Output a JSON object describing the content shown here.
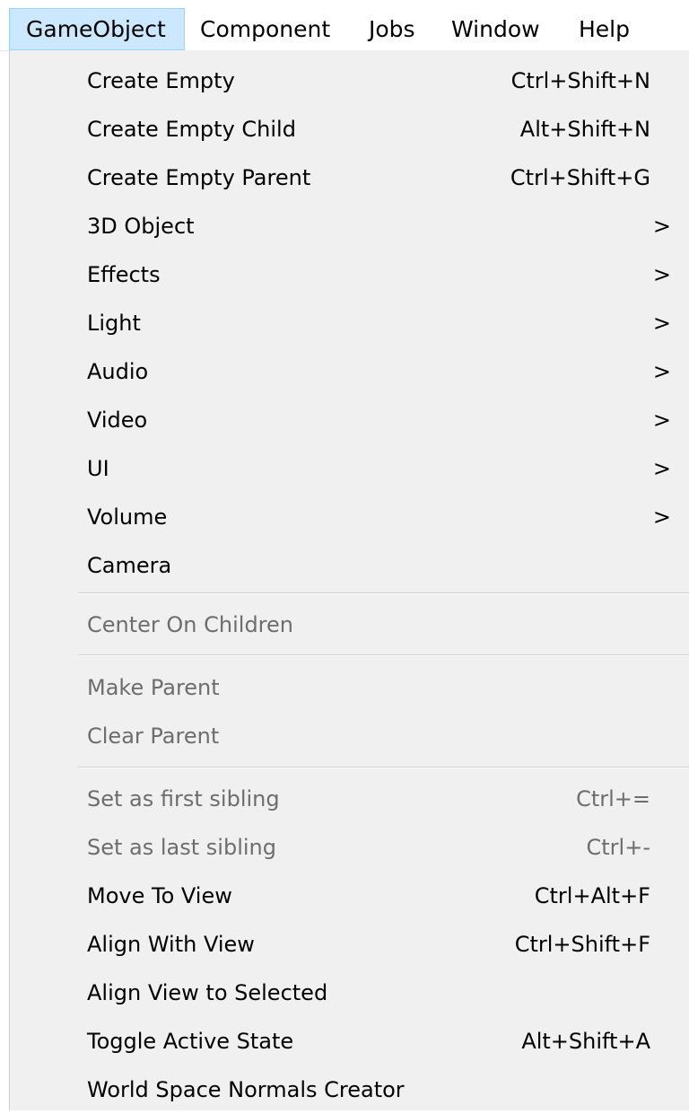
{
  "menubar": {
    "items": [
      {
        "label": "GameObject",
        "active": true
      },
      {
        "label": "Component"
      },
      {
        "label": "Jobs"
      },
      {
        "label": "Window"
      },
      {
        "label": "Help"
      }
    ]
  },
  "dropdown": {
    "items": [
      {
        "label": "Create Empty",
        "shortcut": "Ctrl+Shift+N"
      },
      {
        "label": "Create Empty Child",
        "shortcut": "Alt+Shift+N"
      },
      {
        "label": "Create Empty Parent",
        "shortcut": "Ctrl+Shift+G"
      },
      {
        "label": "3D Object",
        "arrow": ">"
      },
      {
        "label": "Effects",
        "arrow": ">"
      },
      {
        "label": "Light",
        "arrow": ">"
      },
      {
        "label": "Audio",
        "arrow": ">"
      },
      {
        "label": "Video",
        "arrow": ">"
      },
      {
        "label": "UI",
        "arrow": ">"
      },
      {
        "label": "Volume",
        "arrow": ">"
      },
      {
        "label": "Camera"
      },
      {
        "label": "Center On Children"
      },
      {
        "label": "Make Parent"
      },
      {
        "label": "Clear Parent"
      },
      {
        "label": "Set as first sibling",
        "shortcut": "Ctrl+="
      },
      {
        "label": "Set as last sibling",
        "shortcut": "Ctrl+-"
      },
      {
        "label": "Move To View",
        "shortcut": "Ctrl+Alt+F"
      },
      {
        "label": "Align With View",
        "shortcut": "Ctrl+Shift+F"
      },
      {
        "label": "Align View to Selected"
      },
      {
        "label": "Toggle Active State",
        "shortcut": "Alt+Shift+A"
      },
      {
        "label": "World Space Normals Creator"
      }
    ]
  }
}
